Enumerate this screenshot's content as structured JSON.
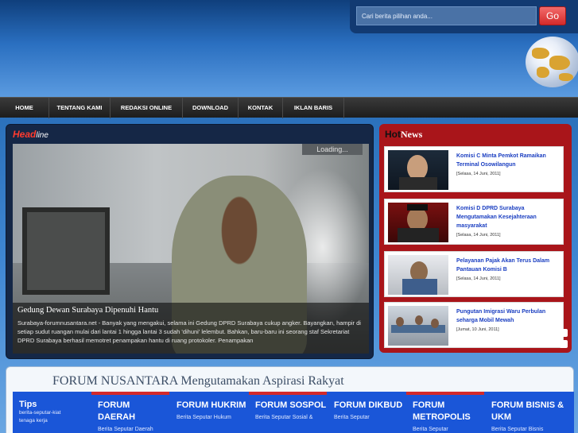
{
  "search": {
    "placeholder": "Cari berita pilihan anda...",
    "go_label": "Go"
  },
  "nav": [
    "HOME",
    "TENTANG KAMI",
    "REDAKSI ONLINE",
    "DOWNLOAD",
    "KONTAK",
    "IKLAN BARIS"
  ],
  "headline": {
    "title_main": "Head",
    "title_sub": "line",
    "loading": "Loading...",
    "caption_title": "Gedung Dewan Surabaya Dipenuhi Hantu",
    "caption_text": "Surabaya-forumnusantara.net - Banyak yang mengakui, selama ini Gedung DPRD Surabaya cukup angker. Bayangkan, hampir di setiap sudut ruangan mulai dari lantai 1 hingga lantai 3 sudah 'dihuni' lelembut. Bahkan, baru-baru ini seorang staf Sekretariat DPRD Surabaya berhasil memotret penampakan hantu di ruang protokoler. Penampakan"
  },
  "hot_news": {
    "title_a": "Hot",
    "title_b": "News",
    "items": [
      {
        "headline": "Komisi C Minta Pemkot Ramaikan Terminal Osowilangun",
        "date": "[Selasa, 14 Juni, 2011]"
      },
      {
        "headline": "Komisi D DPRD Surabaya Mengutamakan Kesejahteraan masyarakat",
        "date": "[Selasa, 14 Juni, 2011]"
      },
      {
        "headline": "Pelayanan Pajak Akan Terus Dalam Pantauan Komisi B",
        "date": "[Selasa, 14 Juni, 2011]"
      },
      {
        "headline": "Pungutan Imigrasi Waru Perbulan seharga Mobil Mewah",
        "date": "[Jumat, 10 Juni, 2011]"
      }
    ]
  },
  "forum": {
    "title": "FORUM NUSANTARA Mengutamakan Aspirasi Rakyat",
    "tips": {
      "head": "Tips",
      "links": [
        "berita-seputar-kiat",
        "tenaga kerja"
      ]
    },
    "columns": [
      {
        "head": "FORUM DAERAH",
        "sub": "Berita Seputar Daerah"
      },
      {
        "head": "FORUM HUKRIM",
        "sub": "Berita Seputar Hukum"
      },
      {
        "head": "FORUM SOSPOL",
        "sub": "Berita Seputar Sosial &"
      },
      {
        "head": "FORUM DIKBUD",
        "sub": "Berita Seputar"
      },
      {
        "head": "FORUM METROPOLIS",
        "sub": "Berita Seputar"
      },
      {
        "head": "FORUM BISNIS & UKM",
        "sub": "Berita Seputar Bisnis"
      }
    ]
  },
  "colors": {
    "accent_red": "#d32a2a",
    "forum_blue": "#1a56d8",
    "headline_dark": "#152746"
  }
}
